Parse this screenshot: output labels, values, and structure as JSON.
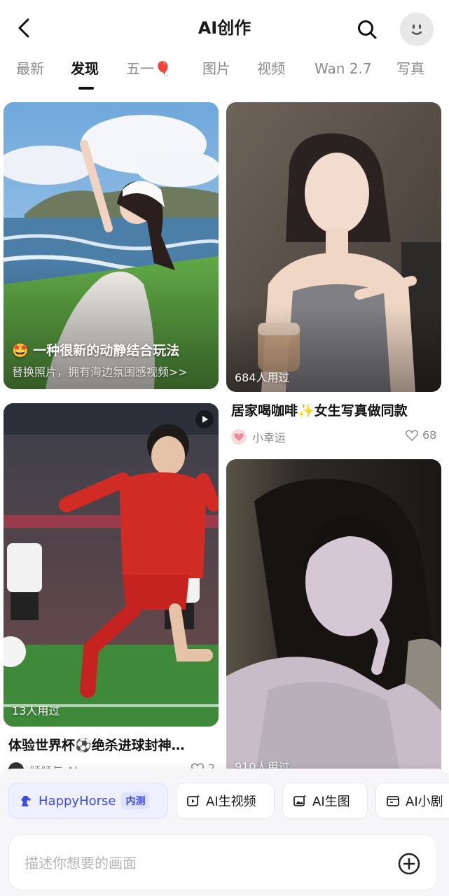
{
  "header": {
    "title": "AI创作"
  },
  "tabs": [
    {
      "label": "最新"
    },
    {
      "label": "发现"
    },
    {
      "label": "五一🎈"
    },
    {
      "label": "图片"
    },
    {
      "label": "视频"
    },
    {
      "label": "Wan 2.7"
    },
    {
      "label": "写真"
    }
  ],
  "feed": {
    "cards": [
      {
        "overlay_title": "🤩 一种很新的动静结合玩法",
        "overlay_subtitle": "替换照片，拥有海边氛围感视频>>"
      },
      {
        "usage": "684人用过",
        "title": "居家喝咖啡✨女生写真做同款",
        "author": "小幸运",
        "likes": "68"
      },
      {
        "usage": "13人用过",
        "title": "体验世界杯⚽绝杀进球封神…",
        "author": "倾倾与 AI",
        "likes": "2"
      },
      {
        "usage": "910人用过"
      }
    ]
  },
  "quick_actions": [
    {
      "label": "HappyHorse",
      "badge": "内测"
    },
    {
      "label": "AI生视频"
    },
    {
      "label": "AI生图"
    },
    {
      "label": "AI小剧"
    }
  ],
  "input": {
    "placeholder": "描述你想要的画面"
  },
  "colors": {
    "accent": "#3d4de6",
    "muted": "#8a8a8a",
    "panel": "#f6f6f8"
  }
}
